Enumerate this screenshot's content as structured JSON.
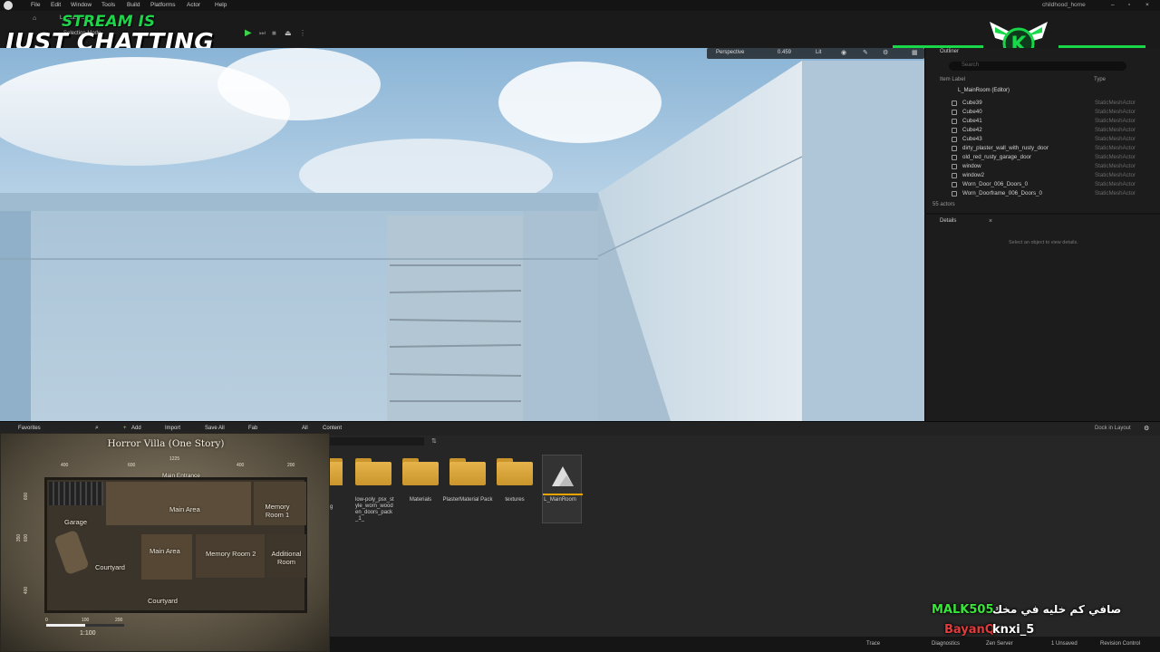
{
  "menubar": {
    "items": [
      "File",
      "Edit",
      "Window",
      "Tools",
      "Build",
      "Platforms",
      "Actor",
      "Help"
    ],
    "project_name": "childhood_home"
  },
  "overlay": {
    "line1": "STREAM IS",
    "line2": "JUST CHATTING"
  },
  "toolbar": {
    "mode_label": "Selection Mode",
    "level_tab": "L_MainRoom"
  },
  "viewport": {
    "perspective_label": "Perspective",
    "speed_value": "0.459",
    "lit_label": "Lit"
  },
  "outliner": {
    "tab_label": "Outliner",
    "search_placeholder": "Search",
    "col_item": "Item Label",
    "col_type": "Type",
    "root": "L_MainRoom (Editor)",
    "rows": [
      {
        "name": "Cube39",
        "type": "StaticMeshActor"
      },
      {
        "name": "Cube40",
        "type": "StaticMeshActor"
      },
      {
        "name": "Cube41",
        "type": "StaticMeshActor"
      },
      {
        "name": "Cube42",
        "type": "StaticMeshActor"
      },
      {
        "name": "Cube43",
        "type": "StaticMeshActor"
      },
      {
        "name": "dirty_plaster_wall_with_rusty_door",
        "type": "StaticMeshActor"
      },
      {
        "name": "old_red_rusty_garage_door",
        "type": "StaticMeshActor"
      },
      {
        "name": "window",
        "type": "StaticMeshActor"
      },
      {
        "name": "window2",
        "type": "StaticMeshActor"
      },
      {
        "name": "Worn_Door_006_Doors_0",
        "type": "StaticMeshActor"
      },
      {
        "name": "Worn_Doorframe_006_Doors_0",
        "type": "StaticMeshActor"
      }
    ],
    "actor_count": "55 actors"
  },
  "details": {
    "tab_label": "Details",
    "empty_text": "Select an object to view details."
  },
  "content_browser": {
    "favorites": "Favorites",
    "add": "Add",
    "import": "Import",
    "save_all": "Save All",
    "fab": "Fab",
    "path_all": "All",
    "path_content": "Content",
    "dock": "Dock in Layout",
    "items": [
      {
        "label": "ping",
        "type": "folder"
      },
      {
        "label": "low-poly_psx_style_worn_wooden_doors_pack_1_",
        "type": "folder"
      },
      {
        "label": "Materials",
        "type": "folder"
      },
      {
        "label": "PlasterMaterial Pack",
        "type": "folder"
      },
      {
        "label": "textures",
        "type": "folder"
      },
      {
        "label": "L_MainRoom",
        "type": "level"
      }
    ]
  },
  "map": {
    "title": "Horror Villa (One Story)",
    "top_ticks": [
      "400",
      "600",
      "1225",
      "400",
      "200"
    ],
    "left_ticks": [
      "600",
      "350",
      "600",
      "400"
    ],
    "rooms": [
      "Main Entrance",
      "Garage",
      "Main Area",
      "Memory Room 1",
      "Main Area",
      "Memory Room 2",
      "Additional Room",
      "Courtyard",
      "Courtyard"
    ],
    "scale_ticks": [
      "0",
      "100",
      "200"
    ],
    "scale_label": "1:100"
  },
  "chat": {
    "line1_user": "MALK505",
    "line1_msg": "صافي كم خليه في مخك",
    "line2_user": "BayanQ",
    "line2_msg": "knxi_5"
  },
  "statusbar": {
    "trace": "Trace",
    "diagnostics": "Diagnostics",
    "zen": "Zen Server",
    "unsaved": "1 Unsaved",
    "revision": "Revision Control"
  },
  "colors": {
    "accent_green": "#18d84a",
    "chat_user1": "#39e639",
    "chat_user2": "#e23b3b",
    "folder": "#e0ad45"
  }
}
